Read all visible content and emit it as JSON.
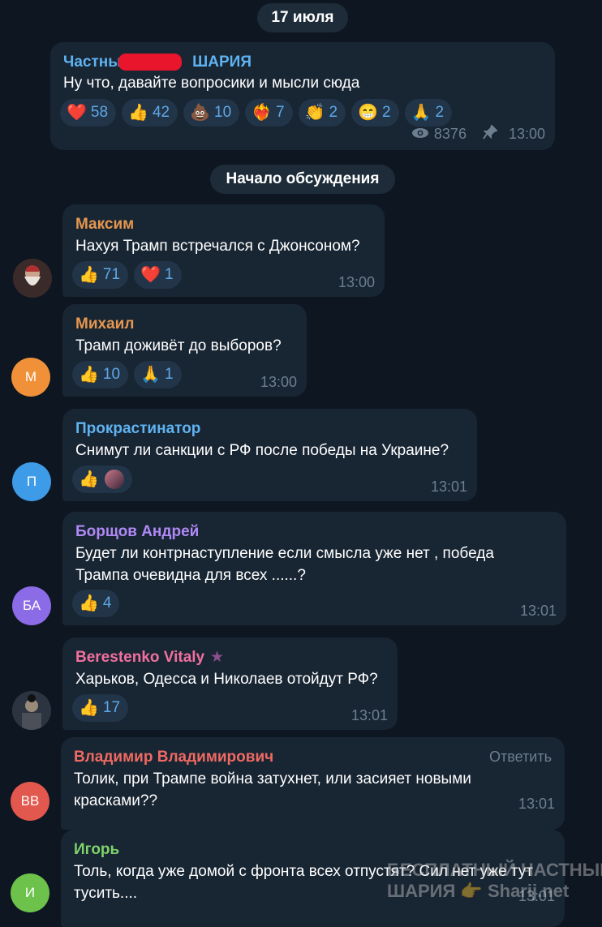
{
  "date_pill": "17 июля",
  "post": {
    "channel": "Частный",
    "channel_suffix": "ШАРИЯ",
    "text": "Ну что, давайте вопросики и мысли сюда",
    "reactions": [
      {
        "emoji": "❤️",
        "count": "58"
      },
      {
        "emoji": "👍",
        "count": "42"
      },
      {
        "emoji": "💩",
        "count": "10"
      },
      {
        "emoji": "❤️‍🔥",
        "count": "7"
      },
      {
        "emoji": "👏",
        "count": "2"
      },
      {
        "emoji": "😁",
        "count": "2"
      },
      {
        "emoji": "🙏",
        "count": "2"
      }
    ],
    "views": "8376",
    "time": "13:00"
  },
  "discussion_pill": "Начало обсуждения",
  "comments": [
    {
      "sender": "Максим",
      "color": "#e6974f",
      "text": [
        "Нахуя Трамп встречался с Джонсоном?"
      ],
      "reactions": [
        {
          "emoji": "👍",
          "count": "71"
        },
        {
          "emoji": "❤️",
          "count": "1"
        }
      ],
      "time": "13:00",
      "avatar": "",
      "avatar_color": "#3a2a2a"
    },
    {
      "sender": "Михаил",
      "color": "#e6974f",
      "text": [
        "Трамп доживёт до выборов?"
      ],
      "reactions": [
        {
          "emoji": "👍",
          "count": "10"
        },
        {
          "emoji": "🙏",
          "count": "1"
        }
      ],
      "time": "13:00",
      "avatar": "М",
      "avatar_color": "#f0913a"
    },
    {
      "sender": "Прокрастинатор",
      "color": "#5fb3f0",
      "text": [
        "Снимут ли санкции с РФ после победы на Украине?"
      ],
      "reactions": [
        {
          "emoji": "👍",
          "count": ""
        }
      ],
      "time": "13:01",
      "avatar": "П",
      "avatar_color": "#3e9be8"
    },
    {
      "sender": "Борщов Андрей",
      "color": "#b089f5",
      "text": [
        "Будет ли контрнаступление  если  смысла уже нет , победа",
        "Трампа очевидна для всех ......?"
      ],
      "reactions": [
        {
          "emoji": "👍",
          "count": "4"
        }
      ],
      "time": "13:01",
      "avatar": "БА",
      "avatar_color": "#8c6be6"
    },
    {
      "sender": "Berestenko Vitaly",
      "color": "#f0709e",
      "text": [
        "Харьков, Одесса и Николаев отойдут РФ?"
      ],
      "reactions": [
        {
          "emoji": "👍",
          "count": "17"
        }
      ],
      "time": "13:01",
      "avatar": "",
      "avatar_color": "#2b3440"
    },
    {
      "sender": "Владимир Владимирович",
      "color": "#f06a62",
      "text": [
        "Толик, при Трампе война затухнет, или засияет новыми",
        "красками??"
      ],
      "reactions": [],
      "time": "13:01",
      "reply": "Ответить",
      "avatar": "ВВ",
      "avatar_color": "#e2584e"
    },
    {
      "sender": "Игорь",
      "color": "#7ed36b",
      "text": [
        "Толь, когда уже домой с фронта всех отпустят? Сил нет уже тут",
        "тусить...."
      ],
      "reactions": [],
      "time": "13:01",
      "avatar": "И",
      "avatar_color": "#6cc24a"
    }
  ],
  "watermark": {
    "line1": "БЕСПЛАТНЫЙ ЧАСТНЫЙ",
    "line2": "ШАРИЯ",
    "site": "Sharij.net"
  },
  "colors": {
    "background": "#0e1621",
    "bubble": "#182533",
    "reaction_bg": "#223447",
    "reaction_text": "#5ea8e8",
    "channel_name": "#5fb3f0"
  }
}
